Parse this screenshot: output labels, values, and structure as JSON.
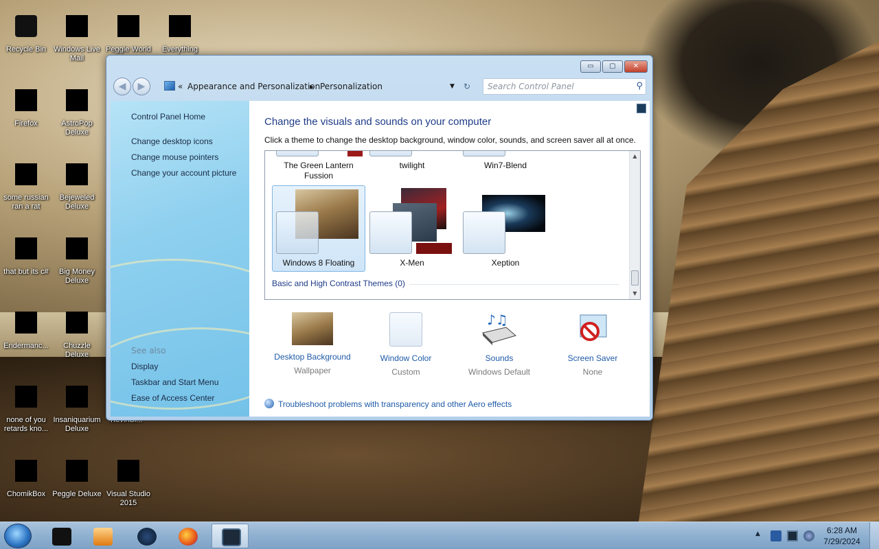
{
  "desktop": {
    "icons": [
      {
        "label": "Recycle Bin"
      },
      {
        "label": "Windows Live Mail"
      },
      {
        "label": "Peggle World of Warcraft"
      },
      {
        "label": "Everything"
      },
      {
        "label": "Firefox"
      },
      {
        "label": "AstroPop Deluxe"
      },
      {
        "label": "some russian ran a rat"
      },
      {
        "label": "Bejeweled Deluxe"
      },
      {
        "label": "that but its c#"
      },
      {
        "label": "Big Money Deluxe"
      },
      {
        "label": "Endermanc..."
      },
      {
        "label": "Chuzzle Deluxe"
      },
      {
        "label": "none of you retards kno..."
      },
      {
        "label": "Insaniquarium Deluxe"
      },
      {
        "label": "KevinSi..."
      },
      {
        "label": "ChomikBox"
      },
      {
        "label": "Peggle Deluxe"
      },
      {
        "label": "Visual Studio 2015"
      }
    ]
  },
  "window": {
    "caption_buttons": {
      "minimize": "▭",
      "maximize": "▢",
      "close": "✕"
    },
    "nav": {
      "back": "◀",
      "forward": "▶"
    },
    "breadcrumb": {
      "chevron": "«",
      "part1": "Appearance and Personalization",
      "sep": "▸",
      "part2": "Personalization"
    },
    "search_placeholder": "Search Control Panel",
    "sidebar": {
      "home": "Control Panel Home",
      "links": [
        "Change desktop icons",
        "Change mouse pointers",
        "Change your account picture"
      ],
      "see_also": "See also",
      "see_links": [
        "Display",
        "Taskbar and Start Menu",
        "Ease of Access Center"
      ]
    },
    "main": {
      "title": "Change the visuals and sounds on your computer",
      "description": "Click a theme to change the desktop background, window color, sounds, and screen saver all at once.",
      "themes_row1": [
        "The Green Lantern Fussion",
        "twilight",
        "Win7-Blend"
      ],
      "themes_row2": [
        "Windows 8 Floating",
        "X-Men",
        "Xeption"
      ],
      "basic_themes": "Basic and High Contrast Themes (0)",
      "options": [
        {
          "name": "Desktop Background",
          "value": "Wallpaper"
        },
        {
          "name": "Window Color",
          "value": "Custom"
        },
        {
          "name": "Sounds",
          "value": "Windows Default"
        },
        {
          "name": "Screen Saver",
          "value": "None"
        }
      ],
      "troubleshoot": "Troubleshoot problems with transparency and other Aero effects"
    }
  },
  "taskbar": {
    "time": "6:28 AM",
    "date": "7/29/2024"
  },
  "colors": {
    "link": "#1e5aa8",
    "title": "#1e3b87"
  }
}
